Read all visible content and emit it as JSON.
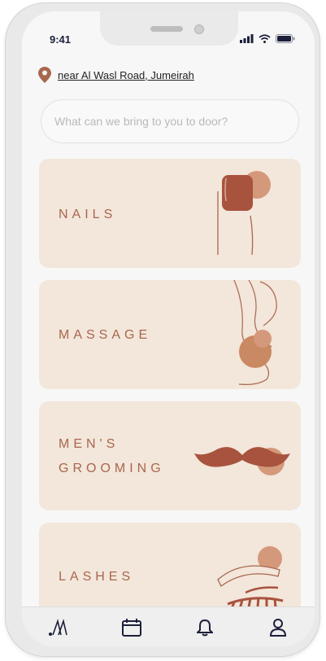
{
  "status": {
    "time": "9:41"
  },
  "location": {
    "text": "near Al Wasl Road, Jumeirah"
  },
  "search": {
    "placeholder": "What can we bring to you to door?"
  },
  "categories": [
    {
      "label": "NAILS",
      "icon": "nail-icon"
    },
    {
      "label": "MASSAGE",
      "icon": "massage-icon"
    },
    {
      "label_line1": "MEN'S",
      "label_line2": "GROOMING",
      "icon": "mustache-icon"
    },
    {
      "label": "LASHES",
      "icon": "lashes-icon"
    }
  ],
  "tabbar": {
    "items": [
      "home-logo-icon",
      "calendar-icon",
      "bell-icon",
      "profile-icon"
    ]
  },
  "colors": {
    "accent": "#a8674e",
    "card_bg": "#f3e6da",
    "circle": "#d4987b"
  }
}
